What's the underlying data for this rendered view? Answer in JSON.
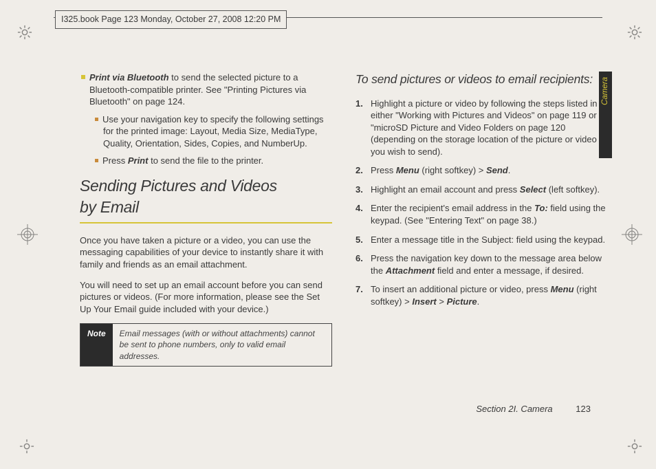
{
  "header": "I325.book  Page 123  Monday, October 27, 2008  12:20 PM",
  "side_tab": "Camera",
  "left": {
    "bullet1_lead": "Print via Bluetooth",
    "bullet1_rest": " to send the selected picture to a Bluetooth-compatible printer. See \"Printing Pictures via Bluetooth\" on page 124.",
    "sub1": "Use your navigation key to specify the following settings for the printed image: Layout, Media Size, MediaType, Quality, Orientation, Sides, Copies, and NumberUp.",
    "sub2_pre": "Press ",
    "sub2_em": "Print",
    "sub2_post": " to send the file to the printer.",
    "h2a": "Sending Pictures and Videos",
    "h2b": "by Email",
    "p1": "Once you have taken a picture or a video, you can use the messaging capabilities of your device to instantly share it with family and friends as an email attachment.",
    "p2": "You will need to set up an email account before you can send pictures or videos. (For more information, please see the Set Up Your Email guide included with your device.)",
    "note_label": "Note",
    "note_text": "Email messages (with or without attachments) cannot be sent to phone numbers, only to valid email addresses."
  },
  "right": {
    "h3": "To send pictures or videos to email recipients:",
    "s1": "Highlight a picture or video by following the steps listed in either \"Working with Pictures and Videos\" on page 119 or \"microSD Picture and Video Folders on page 120 (depending on the storage location of the picture or video you wish to send).",
    "s2_pre": "Press ",
    "s2_em1": "Menu",
    "s2_mid": " (right softkey) > ",
    "s2_em2": "Send",
    "s2_post": ".",
    "s3_pre": "Highlight an email account and press ",
    "s3_em": "Select",
    "s3_post": " (left softkey).",
    "s4_pre": "Enter the recipient's email address in the ",
    "s4_em": "To:",
    "s4_post": " field using the keypad. (See \"Entering Text\" on page 38.)",
    "s5": "Enter a message title in the Subject: field using the keypad.",
    "s6_pre": "Press the navigation key down to the message area below the ",
    "s6_em": "Attachment",
    "s6_post": " field and enter a message, if desired.",
    "s7_pre": "To insert an additional picture or video, press ",
    "s7_em1": "Menu",
    "s7_mid1": " (right softkey) > ",
    "s7_em2": "Insert",
    "s7_mid2": " > ",
    "s7_em3": "Picture",
    "s7_post": "."
  },
  "footer_section": "Section 2I. Camera",
  "footer_page": "123"
}
